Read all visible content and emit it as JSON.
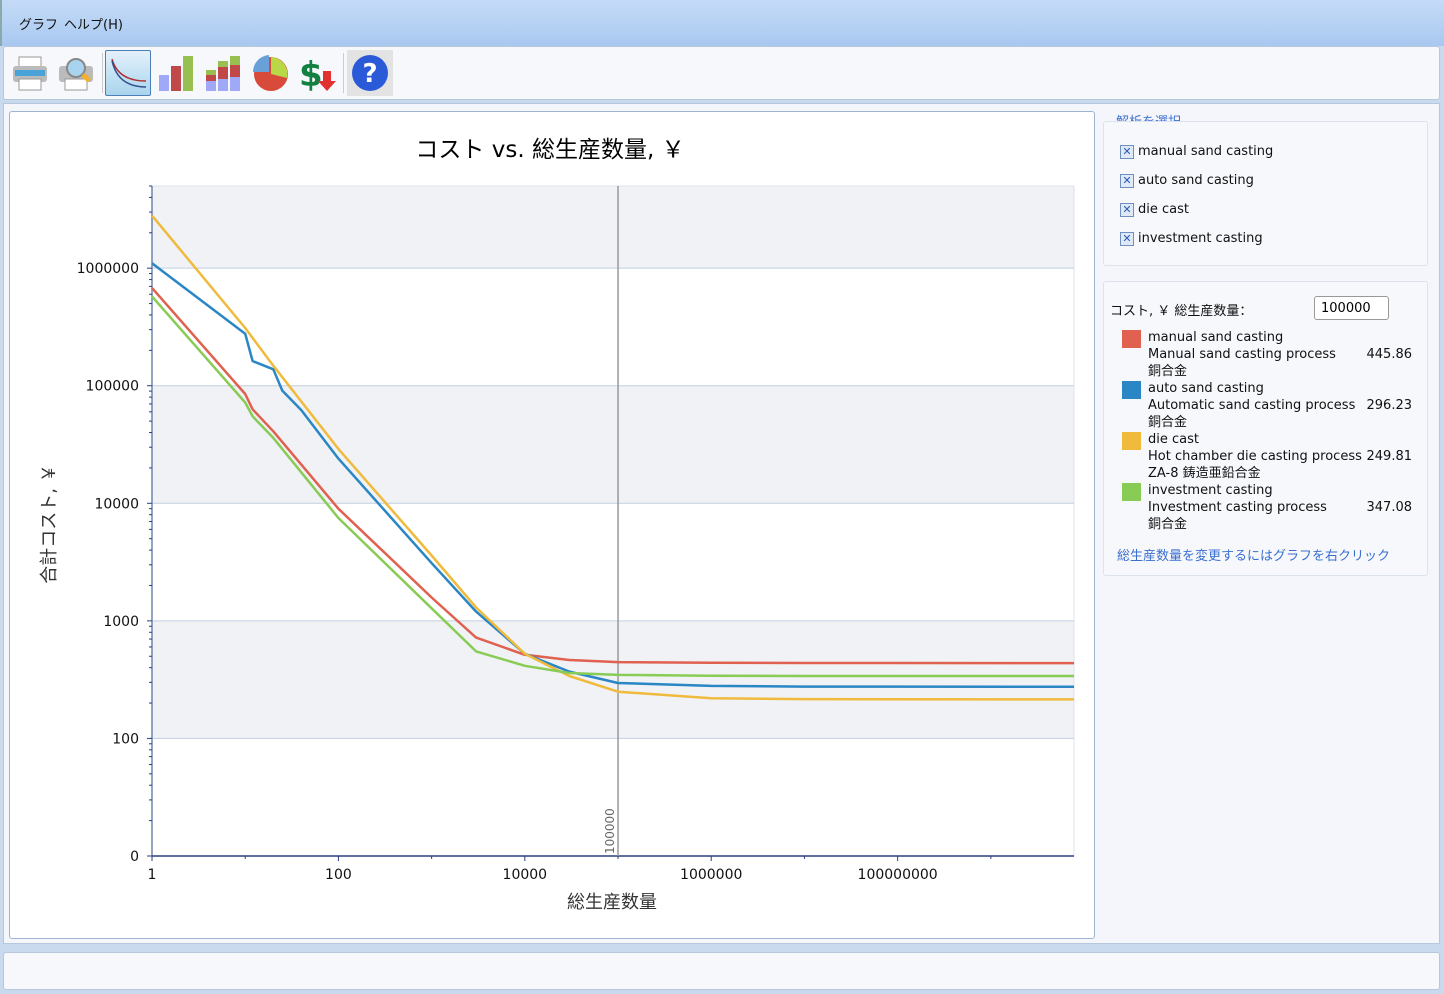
{
  "menu": {
    "items": [
      "グラフ",
      "ヘルプ(H)"
    ]
  },
  "toolbar": {
    "icons": [
      "printer-icon",
      "print-preview-icon",
      "line-chart-icon",
      "bar-chart-icon",
      "stacked-bar-chart-icon",
      "pie-chart-icon",
      "cost-down-icon",
      "help-icon"
    ],
    "active": "line-chart-icon"
  },
  "analysis": {
    "title": "解析を選択",
    "items": [
      {
        "label": "manual sand casting",
        "checked": true
      },
      {
        "label": "auto sand casting",
        "checked": true
      },
      {
        "label": "die cast",
        "checked": true
      },
      {
        "label": "investment casting",
        "checked": true
      }
    ]
  },
  "cost": {
    "label": "コスト, ￥ 総生産数量：",
    "quantity": "100000",
    "items": [
      {
        "name": "manual sand casting",
        "process": "Manual sand casting process",
        "material": "銅合金",
        "value": "445.86",
        "color": "#e06150"
      },
      {
        "name": "auto sand casting",
        "process": "Automatic sand casting process",
        "material": "銅合金",
        "value": "296.23",
        "color": "#2a86c4"
      },
      {
        "name": "die cast",
        "process": "Hot chamber die casting process",
        "material": "ZA-8 鋳造亜鉛合金",
        "value": "249.81",
        "color": "#f0bb3c"
      },
      {
        "name": "investment casting",
        "process": "Investment casting process",
        "material": "銅合金",
        "value": "347.08",
        "color": "#88cc55"
      }
    ],
    "hint": "総生産数量を変更するにはグラフを右クリック"
  },
  "chart_data": {
    "type": "line",
    "title": "コスト vs. 総生産数量, ￥",
    "xlabel": "総生産数量",
    "ylabel": "合計コスト, ￥",
    "xscale": "log",
    "yscale": "log",
    "xlim": [
      1,
      7800000000
    ],
    "ylim": [
      10,
      5000000
    ],
    "xticks": [
      {
        "v": 1,
        "label": "1"
      },
      {
        "v": 100,
        "label": "100"
      },
      {
        "v": 10000,
        "label": "10000"
      },
      {
        "v": 1000000,
        "label": "1000000"
      },
      {
        "v": 100000000,
        "label": "100000000"
      }
    ],
    "yticks": [
      {
        "v": 10,
        "label": "0"
      },
      {
        "v": 100,
        "label": "100"
      },
      {
        "v": 1000,
        "label": "1000"
      },
      {
        "v": 10000,
        "label": "10000"
      },
      {
        "v": 100000,
        "label": "100000"
      },
      {
        "v": 1000000,
        "label": "1000000"
      }
    ],
    "marker": {
      "x": 100000,
      "label": "100000"
    },
    "grid": true,
    "series": [
      {
        "name": "manual sand casting",
        "color": "#e06150",
        "x": [
          1,
          10,
          12,
          20,
          100,
          1000,
          3000,
          10000,
          30000,
          100000,
          1000000,
          10000000,
          7800000000
        ],
        "y": [
          680000,
          85000,
          63000,
          41000,
          9000,
          1580,
          720,
          515,
          465,
          446,
          440,
          438,
          437
        ]
      },
      {
        "name": "auto sand casting",
        "color": "#2a86c4",
        "x": [
          1,
          10,
          12,
          20,
          25,
          40,
          100,
          1000,
          3000,
          10000,
          30000,
          100000,
          1000000,
          10000000,
          7800000000
        ],
        "y": [
          1100000,
          277000,
          162000,
          138000,
          91000,
          62000,
          24000,
          3100,
          1200,
          525,
          370,
          296,
          280,
          276,
          275
        ]
      },
      {
        "name": "die cast",
        "color": "#f0bb3c",
        "x": [
          1,
          10,
          20,
          100,
          1000,
          3000,
          10000,
          30000,
          100000,
          1000000,
          10000000,
          7800000000
        ],
        "y": [
          2800000,
          310000,
          148000,
          29000,
          3600,
          1300,
          525,
          340,
          250,
          220,
          216,
          215
        ]
      },
      {
        "name": "investment casting",
        "color": "#88cc55",
        "x": [
          1,
          10,
          12,
          20,
          100,
          1000,
          3000,
          10000,
          30000,
          100000,
          1000000,
          10000000,
          7800000000
        ],
        "y": [
          575000,
          72000,
          55000,
          36000,
          7500,
          1280,
          550,
          415,
          360,
          347,
          342,
          340,
          340
        ]
      }
    ]
  }
}
